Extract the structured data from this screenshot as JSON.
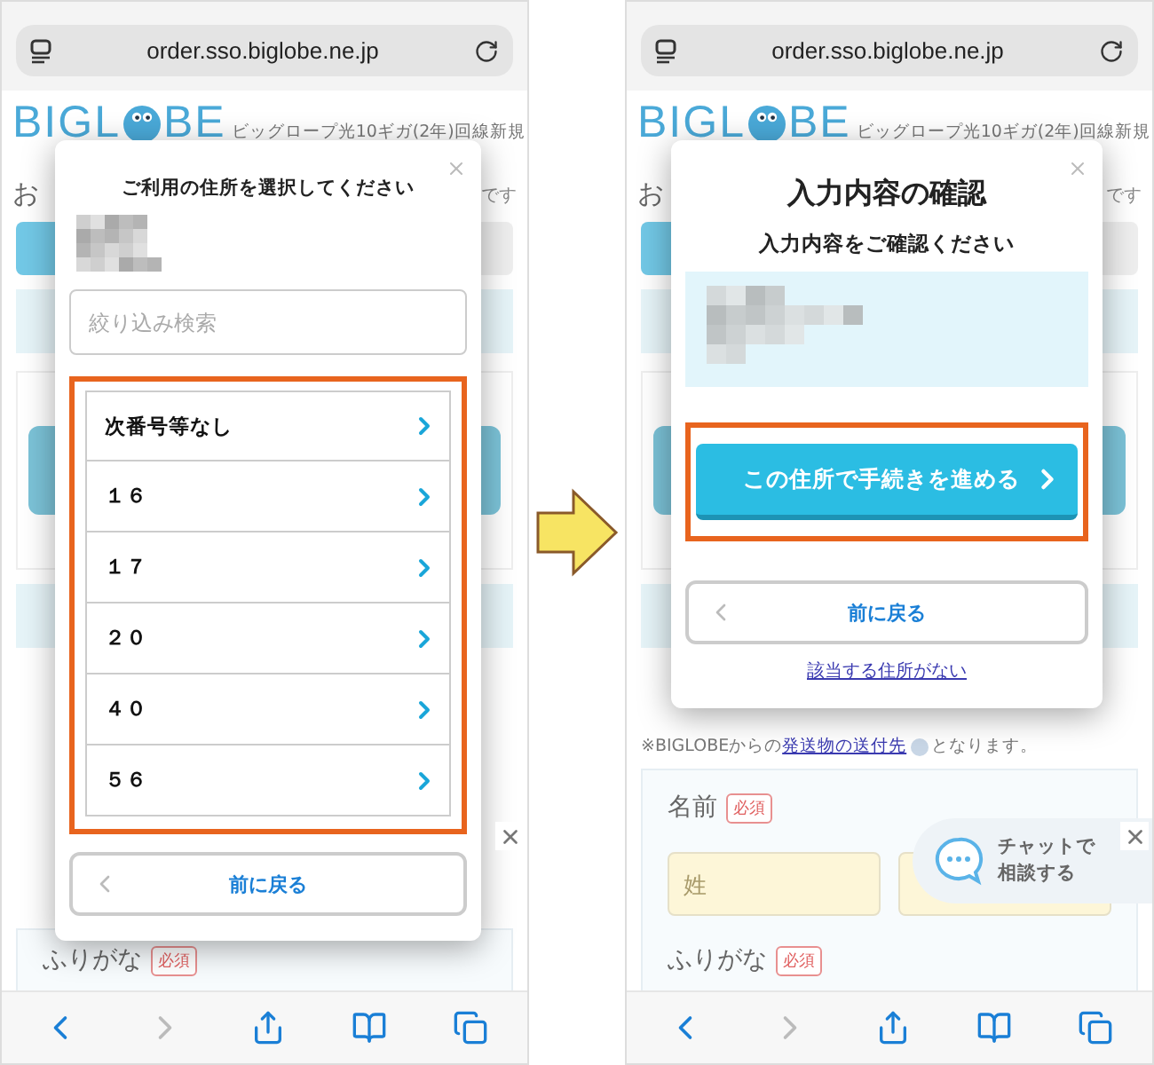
{
  "screens": [
    {
      "kind": "select",
      "browser": {
        "url": "order.sso.biglobe.ne.jp"
      },
      "header": {
        "logo_left": "BIGL",
        "logo_right": "BE",
        "subtitle": "ビッグロープ光10ギガ(2年)回線新規"
      },
      "notice": {
        "left": "お",
        "right": "です"
      },
      "modal": {
        "title": "ご利用の住所を選択してください",
        "search_placeholder": "絞り込み検索",
        "options": [
          {
            "label": "次番号等なし"
          },
          {
            "label": "１６"
          },
          {
            "label": "１７"
          },
          {
            "label": "２０"
          },
          {
            "label": "４０"
          },
          {
            "label": "５６"
          }
        ],
        "back_button": "前に戻る"
      },
      "fields": [
        {
          "label": "ふりがな",
          "badge": "必須"
        }
      ]
    },
    {
      "kind": "confirm",
      "browser": {
        "url": "order.sso.biglobe.ne.jp"
      },
      "header": {
        "logo_left": "BIGL",
        "logo_right": "BE",
        "subtitle": "ビッグロープ光10ギガ(2年)回線新規"
      },
      "notice": {
        "left": "お",
        "right": "です"
      },
      "modal": {
        "title": "入力内容の確認",
        "subtitle": "入力内容をご確認ください",
        "proceed_button": "この住所で手続きを進める",
        "back_button": "前に戻る",
        "link": "該当する住所がない"
      },
      "note": {
        "before": "※BIGLOBEからの",
        "link": "発送物の送付先",
        "after": "となります。"
      },
      "fields": [
        {
          "label": "名前",
          "badge": "必須",
          "inputs": [
            {
              "placeholder": "姓"
            }
          ]
        },
        {
          "label": "ふりがな",
          "badge": "必須"
        }
      ],
      "chat": {
        "lines": [
          "チャットで",
          "相談する"
        ]
      }
    }
  ]
}
